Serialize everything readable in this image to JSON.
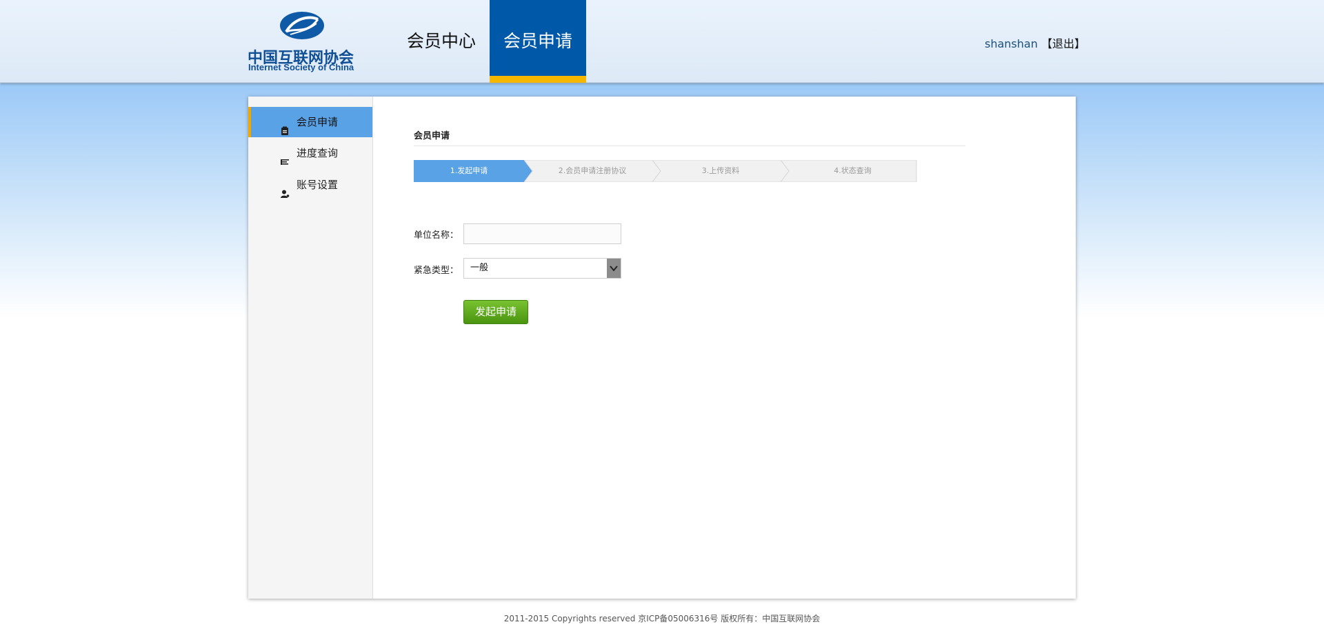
{
  "header": {
    "logo_cn": "中国互联网协会",
    "logo_en": "Internet Society of China",
    "nav": [
      {
        "label": "会员中心"
      },
      {
        "label": "会员申请"
      }
    ],
    "username": "shanshan",
    "logout": "【退出】"
  },
  "sidebar": {
    "items": [
      {
        "label": "会员申请",
        "icon": "clipboard-icon",
        "active": true
      },
      {
        "label": "进度查询",
        "icon": "list-icon",
        "active": false
      },
      {
        "label": "账号设置",
        "icon": "user-settings-icon",
        "active": false
      }
    ]
  },
  "content": {
    "title": "会员申请",
    "steps": [
      {
        "label": "1.发起申请",
        "active": true
      },
      {
        "label": "2.会员申请注册协议",
        "active": false
      },
      {
        "label": "3.上传资料",
        "active": false
      },
      {
        "label": "4.状态查询",
        "active": false
      }
    ],
    "form": {
      "org_label": "单位名称：",
      "org_value": "",
      "urgency_label": "紧急类型：",
      "urgency_value": "一般",
      "submit": "发起申请"
    }
  },
  "footer": "2011-2015 Copyrights reserved 京ICP备05006316号 版权所有：中国互联网协会",
  "colors": {
    "brand_blue": "#0058a8",
    "accent_yellow": "#f5b700",
    "active_sidebar": "#5aa2e6",
    "active_step": "#5aa2e6",
    "submit_green": "#5aa81e"
  }
}
